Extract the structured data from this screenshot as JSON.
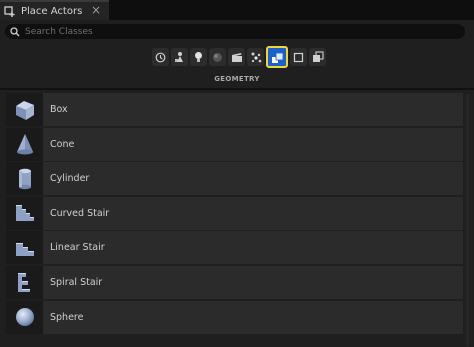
{
  "tab": {
    "title": "Place Actors",
    "close": "×",
    "icon": "place-actors-icon"
  },
  "search": {
    "placeholder": "Search Classes",
    "value": ""
  },
  "categories": [
    {
      "name": "recent-icon"
    },
    {
      "name": "basic-icon"
    },
    {
      "name": "lights-icon"
    },
    {
      "name": "shapes-icon"
    },
    {
      "name": "cinematic-icon"
    },
    {
      "name": "visual-effects-icon"
    },
    {
      "name": "geometry-icon",
      "active": true
    },
    {
      "name": "volumes-icon"
    },
    {
      "name": "all-classes-icon"
    }
  ],
  "selected_category": "GEOMETRY",
  "items": [
    {
      "label": "Box",
      "icon": "box-icon"
    },
    {
      "label": "Cone",
      "icon": "cone-icon"
    },
    {
      "label": "Cylinder",
      "icon": "cylinder-icon"
    },
    {
      "label": "Curved Stair",
      "icon": "curved-stair-icon"
    },
    {
      "label": "Linear Stair",
      "icon": "linear-stair-icon"
    },
    {
      "label": "Spiral Stair",
      "icon": "spiral-stair-icon"
    },
    {
      "label": "Sphere",
      "icon": "sphere-icon"
    }
  ],
  "colors": {
    "accent": "#1a62c8",
    "highlight": "#f2d33a",
    "panel": "#1f1f1f",
    "row": "#2b2b2b"
  }
}
